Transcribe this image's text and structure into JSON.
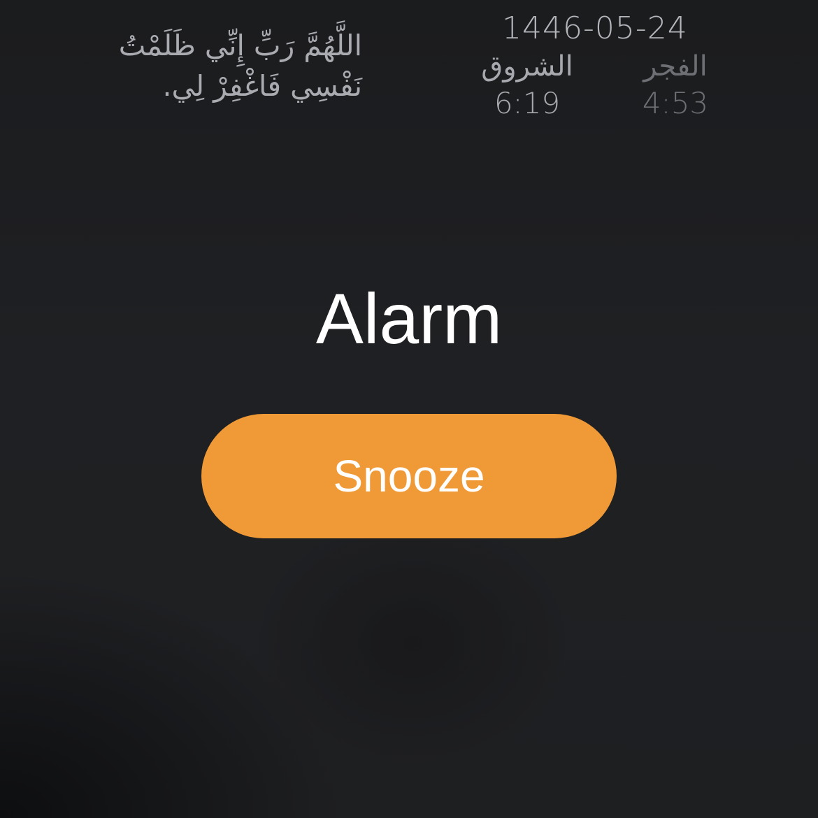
{
  "header": {
    "dua_line_1": "اللَّهُمَّ رَبِّ إِنِّي ظَلَمْتُ",
    "dua_line_2": "نَفْسِي فَاغْفِرْ لِي.",
    "hijri_date": "1446-05-24",
    "prayers": [
      {
        "name": "الشروق",
        "time": "6:19"
      },
      {
        "name": "الفجر",
        "time": "4:53"
      }
    ]
  },
  "alarm": {
    "title": "Alarm",
    "snooze_label": "Snooze"
  },
  "colors": {
    "background": "#1e1f21",
    "snooze_button": "#f09a37",
    "title_text": "#ffffff",
    "dua_text": "#a9abb0",
    "fajr_text": "#6d6f74"
  }
}
